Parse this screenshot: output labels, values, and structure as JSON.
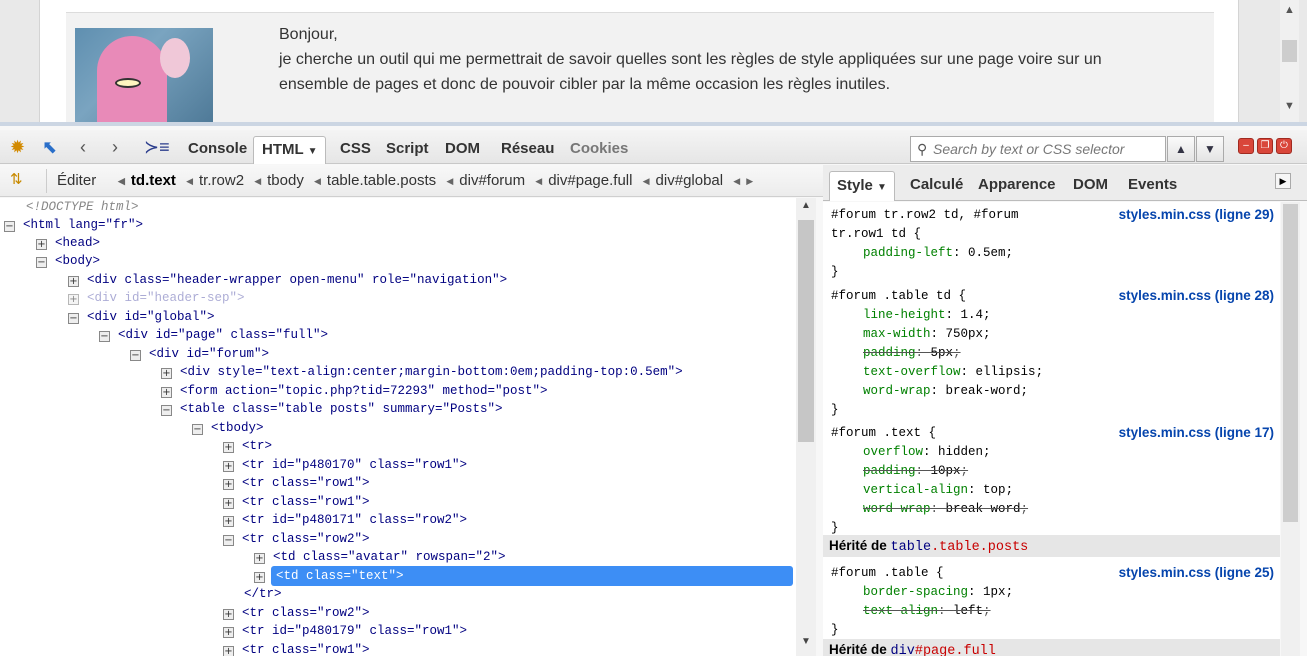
{
  "webpage": {
    "post_text_1": "Bonjour,",
    "post_text_2": "je cherche un outil qui me permettrait de savoir quelles sont les règles de style appliquées sur une page voire sur un",
    "post_text_3": "ensemble de pages et donc de pouvoir cibler par la même occasion les règles inutiles."
  },
  "toolbar": {
    "tabs": [
      "Console",
      "HTML",
      "CSS",
      "Script",
      "DOM",
      "Réseau",
      "Cookies"
    ],
    "active_tab": "HTML",
    "search_placeholder": "Search by text or CSS selector",
    "icons": [
      "firebug-bug-icon",
      "inspect-pointer-icon",
      "back-icon",
      "forward-icon",
      "command-line-icon"
    ]
  },
  "bar2": {
    "edit_label": "Éditer",
    "breadcrumbs": [
      "td.text",
      "tr.row2",
      "tbody",
      "table.table.posts",
      "div#forum",
      "div#page.full",
      "div#global"
    ]
  },
  "tree": {
    "doctype": "<!DOCTYPE html>",
    "lines": [
      "<html lang=\"fr\">",
      "<head>",
      "<body>",
      "<div class=\"header-wrapper open-menu\" role=\"navigation\">",
      "<div id=\"header-sep\">",
      "<div id=\"global\">",
      "<div id=\"page\" class=\"full\">",
      "<div id=\"forum\">",
      "<div style=\"text-align:center;margin-bottom:0em;padding-top:0.5em\">",
      "<form action=\"topic.php?tid=72293\" method=\"post\">",
      "<table class=\"table posts\" summary=\"Posts\">",
      "<tbody>",
      "<tr>",
      "<tr id=\"p480170\" class=\"row1\">",
      "<tr class=\"row1\">",
      "<tr class=\"row1\">",
      "<tr id=\"p480171\" class=\"row2\">",
      "<tr class=\"row2\">",
      "<td class=\"avatar\" rowspan=\"2\">",
      "<td class=\"text\">",
      "</tr>",
      "<tr class=\"row2\">",
      "<tr id=\"p480179\" class=\"row1\">",
      "<tr class=\"row1\">"
    ]
  },
  "style_panel": {
    "tabs": [
      "Style",
      "Calculé",
      "Apparence",
      "DOM",
      "Events"
    ],
    "active_tab": "Style",
    "rule1": {
      "sel1": "#forum tr.row2 td, #forum",
      "sel2": "tr.row1 td {",
      "p1": "padding-left",
      "v1": "0.5em",
      "close": "}",
      "src": "styles.min.css (ligne 29)"
    },
    "rule2": {
      "sel": "#forum .table td {",
      "p1": "line-height",
      "v1": "1.4",
      "p2": "max-width",
      "v2": "750px",
      "p3": "padding",
      "v3": "5px",
      "p4": "text-overflow",
      "v4": "ellipsis",
      "p5": "word-wrap",
      "v5": "break-word",
      "close": "}",
      "src": "styles.min.css (ligne 28)"
    },
    "rule3": {
      "sel": "#forum .text {",
      "p1": "overflow",
      "v1": "hidden",
      "p2": "padding",
      "v2": "10px",
      "p3": "vertical-align",
      "v3": "top",
      "p4": "word-wrap",
      "v4": "break-word",
      "close": "}",
      "src": "styles.min.css (ligne 17)"
    },
    "inherit1": {
      "label": "Hérité de",
      "tag": "table",
      "cls": ".table.posts"
    },
    "rule4": {
      "sel": "#forum .table {",
      "p1": "border-spacing",
      "v1": "1px",
      "p2": "text-align",
      "v2": "left",
      "close": "}",
      "src": "styles.min.css (ligne 25)"
    },
    "inherit2": {
      "label": "Hérité de",
      "tag": "div",
      "cls": "#page",
      "cls2": ".full"
    }
  }
}
